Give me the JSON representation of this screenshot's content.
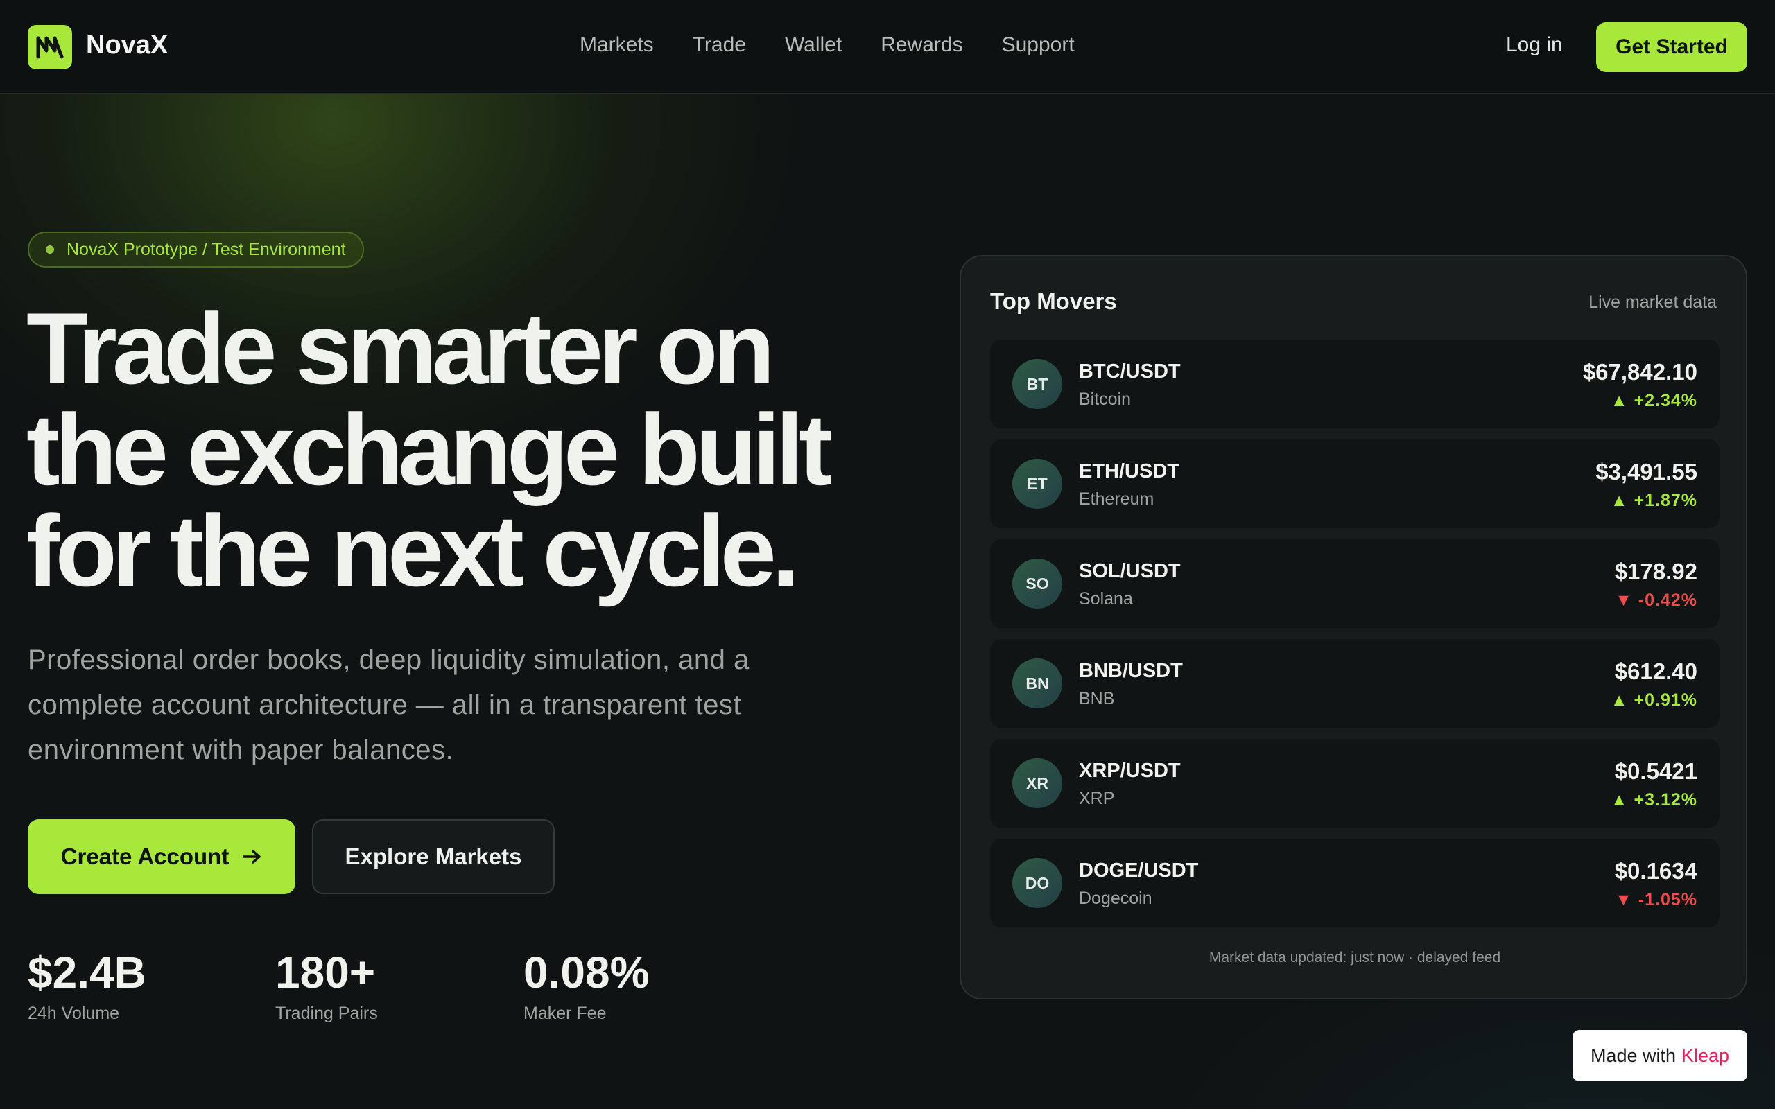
{
  "brand": {
    "name": "NovaX",
    "logo": "nm-monogram-icon",
    "accent": "#a8e83a"
  },
  "nav": [
    "Markets",
    "Trade",
    "Wallet",
    "Rewards",
    "Support"
  ],
  "header": {
    "login": "Log in",
    "cta": "Get Started"
  },
  "hero": {
    "badge": "NovaX Prototype / Test Environment",
    "title_lines": [
      "Trade smarter on",
      "the exchange built",
      "for the next cycle."
    ],
    "subtitle": "Professional order books, deep liquidity simulation, and a complete account architecture — all in a transparent test environment with paper balances.",
    "primary_cta": "Create Account",
    "primary_cta_icon": "arrow-right-icon",
    "secondary_cta": "Explore Markets"
  },
  "stats": [
    {
      "value": "$2.4B",
      "label": "24h Volume"
    },
    {
      "value": "180+",
      "label": "Trading Pairs"
    },
    {
      "value": "0.08%",
      "label": "Maker Fee"
    }
  ],
  "movers": {
    "title": "Top Movers",
    "subtitle": "Live market data",
    "rows": [
      {
        "abbr": "BT",
        "pair": "BTC/USDT",
        "name": "Bitcoin",
        "price": "$67,842.10",
        "change": "+2.34%",
        "dir": "up"
      },
      {
        "abbr": "ET",
        "pair": "ETH/USDT",
        "name": "Ethereum",
        "price": "$3,491.55",
        "change": "+1.87%",
        "dir": "up"
      },
      {
        "abbr": "SO",
        "pair": "SOL/USDT",
        "name": "Solana",
        "price": "$178.92",
        "change": "-0.42%",
        "dir": "down"
      },
      {
        "abbr": "BN",
        "pair": "BNB/USDT",
        "name": "BNB",
        "price": "$612.40",
        "change": "+0.91%",
        "dir": "up"
      },
      {
        "abbr": "XR",
        "pair": "XRP/USDT",
        "name": "XRP",
        "price": "$0.5421",
        "change": "+3.12%",
        "dir": "up"
      },
      {
        "abbr": "DO",
        "pair": "DOGE/USDT",
        "name": "Dogecoin",
        "price": "$0.1634",
        "change": "-1.05%",
        "dir": "down"
      }
    ],
    "footnote": "Market data updated: just now · delayed feed",
    "colors": {
      "up": "#a8e83a",
      "down": "#f04b4b"
    }
  },
  "made_with": {
    "prefix": "Made with",
    "name": "Kleap"
  }
}
